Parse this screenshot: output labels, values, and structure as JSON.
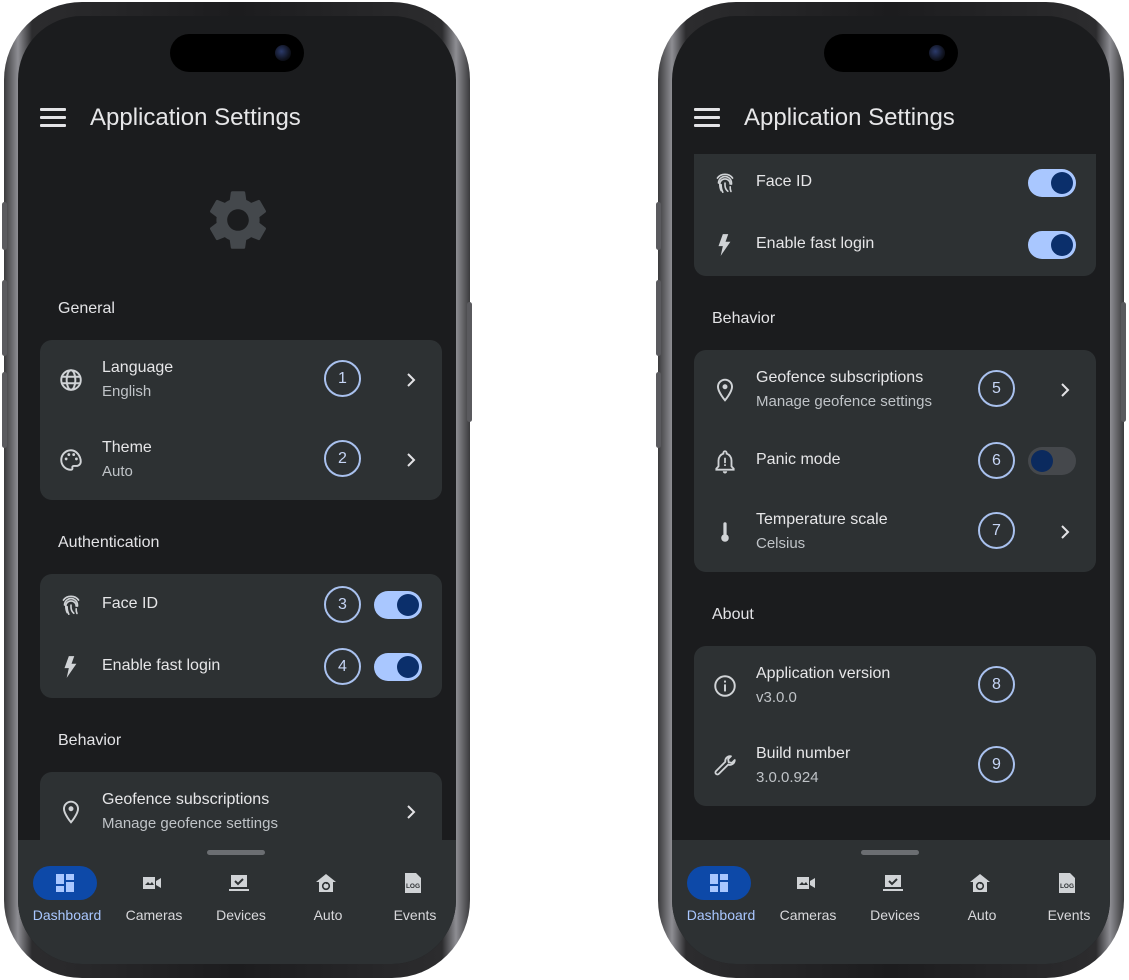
{
  "app": {
    "title": "Application Settings"
  },
  "sections": {
    "general": "General",
    "authentication": "Authentication",
    "behavior": "Behavior",
    "about": "About"
  },
  "items": {
    "language": {
      "label": "Language",
      "value": "English",
      "badge": "1"
    },
    "theme": {
      "label": "Theme",
      "value": "Auto",
      "badge": "2"
    },
    "face_id": {
      "label": "Face ID",
      "badge": "3",
      "enabled": true
    },
    "fast_login": {
      "label": "Enable fast login",
      "badge": "4",
      "enabled": true
    },
    "geofence": {
      "label": "Geofence subscriptions",
      "value": "Manage geofence settings",
      "badge": "5"
    },
    "panic": {
      "label": "Panic mode",
      "badge": "6",
      "enabled": false
    },
    "temperature": {
      "label": "Temperature scale",
      "value": "Celsius",
      "badge": "7"
    },
    "app_version": {
      "label": "Application version",
      "value": "v3.0.0",
      "badge": "8"
    },
    "build_number": {
      "label": "Build number",
      "value": "3.0.0.924",
      "badge": "9"
    }
  },
  "nav": {
    "dashboard": "Dashboard",
    "cameras": "Cameras",
    "devices": "Devices",
    "auto": "Auto",
    "events": "Events",
    "events_icon_text": "LOG"
  },
  "colors": {
    "background": "#1b1c1e",
    "card": "#2d3133",
    "accent": "#a9c7ff",
    "active_pill": "#0d49a8",
    "badge_ring": "#a9c1ee"
  },
  "icons": {
    "menu": "hamburger-icon",
    "settings": "gear-icon",
    "language": "globe-icon",
    "theme": "palette-icon",
    "face_id": "fingerprint-icon",
    "fast_login": "bolt-icon",
    "geofence": "location-pin-icon",
    "panic": "alarm-bell-icon",
    "temperature": "thermometer-icon",
    "version": "info-icon",
    "build": "wrench-icon"
  }
}
